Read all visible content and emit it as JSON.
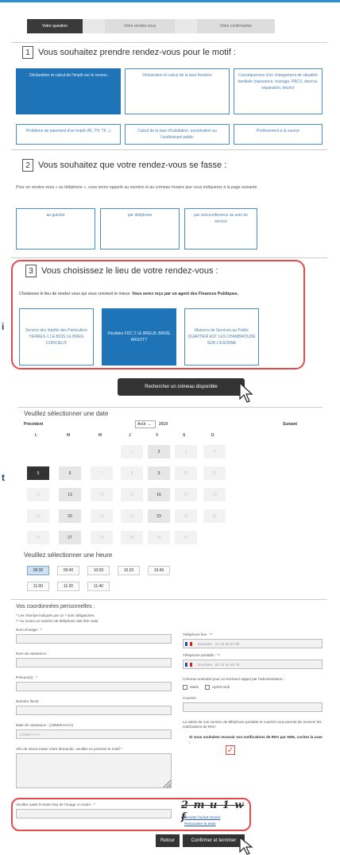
{
  "steps": [
    "Votre question",
    "Votre rendez-vous",
    "Votre confirmation"
  ],
  "s1": {
    "num": "1",
    "title": "Vous souhaitez prendre rendez-vous pour le motif :",
    "cards": [
      "Déclaration et calcul de l'impôt sur le revenu",
      "Déclaration et calcul de la taxe foncière",
      "Conséquences d'un changement de situation familiale (naissance, mariage, PACS, divorce, séparation, décès)",
      "Problème de paiement d'un impôt (IR, TH, TF...)",
      "Calcul de la taxe d'habitation, exonération ou l'audiovisuel public",
      "Prélèvement à la source"
    ]
  },
  "s2": {
    "num": "2",
    "title": "Vous souhaitez que votre rendez-vous se fasse :",
    "para": "Pour un rendez-vous « au téléphone », vous serez rappelé au numéro et au créneau horaire que vous indiquerez à la page suivante.",
    "cards": [
      "au guichet",
      "par téléphone",
      "par visioconférence au sein du service"
    ]
  },
  "s3": {
    "num": "3",
    "title": "Vous choisissez le lieu de votre rendez-vous :",
    "para_a": "Choisissez le lieu de rendez vous qui vous convient le mieux. ",
    "para_b": "Vous serez reçu par un agent des Finances Publiques.",
    "cards": [
      "Service des Impôts des Particuliers YERRES-1 LE BOIS LE BREG CORCIEUX",
      "Flexibles FDC 2 LE BREUIL BRIDE ARGOTT",
      "Maisons de Services au Public QUARTIER EST LES CHAMBROUDE SUR L'ESONNE"
    ]
  },
  "search_btn": "Rechercher un créneau disponible",
  "side": [
    "i",
    "t"
  ],
  "cal": {
    "title": "Veuillez sélectionner une date",
    "prev": "Précédent",
    "next": "Suivant",
    "month": "Août",
    "year": "2019",
    "days": [
      "L",
      "M",
      "M",
      "J",
      "V",
      "S",
      "D"
    ],
    "weeks": [
      [
        "",
        "",
        "",
        "1",
        "2",
        "3",
        "4"
      ],
      [
        "5",
        "6",
        "7",
        "8",
        "9",
        "10",
        "11"
      ],
      [
        "12",
        "13",
        "14",
        "15",
        "16",
        "17",
        "18"
      ],
      [
        "19",
        "20",
        "21",
        "22",
        "23",
        "24",
        "25"
      ],
      [
        "26",
        "27",
        "28",
        "29",
        "30",
        "31",
        ""
      ]
    ],
    "hours_title": "Veuillez sélectionner une heure",
    "hours": [
      "09:30",
      "09:40",
      "10:00",
      "10:20",
      "10:40",
      "11:00",
      "11:20",
      "11:40"
    ]
  },
  "form": {
    "title": "Vos coordonnées personnelles :",
    "note1": "* Les champs indiqués par un * sont obligatoires.",
    "note2": "** Au moins un numéro de téléphone doit être saisi.",
    "nom": "Nom d'usage : *",
    "naissance": "Nom de naissance :",
    "prenom": "Prénom(s) : *",
    "fiscal": "Numéro fiscal :",
    "date": "Date de naissance : (JJ/MM/AAAA)",
    "date_ph": "JJ/MM/YYYY",
    "motif": "Afin de mieux traiter votre demande, veuillez en préciser le motif *",
    "tel_fixe": "Téléphone fixe : **",
    "tel_fixe_ph": "Exemple : 01 23 45 67 89",
    "tel_port": "Téléphone portable : **",
    "tel_port_ph": "Exemple : 06 12 34 56 78",
    "creneau": "Créneau souhaité pour un éventuel rappel par l'administration :",
    "matin": "Matin",
    "apres": "Après-midi",
    "courriel": "Courriel :",
    "notice": "La saisie de vos numéro de téléphone portable et courriel vous permet de recevoir les notifications de RDV",
    "sms": "Si vous souhaitez recevoir vos notifications de RDV par SMS, cochez la case :",
    "captcha_label": "Veuillez saisir le texte issu de l'image ci-contre : *",
    "captcha_text": "2 m u 1 w f",
    "ecouter": "Écouter l'achat sonore",
    "renouveler": "Renouveler le texte"
  },
  "retour": "Retour",
  "confirmer": "Confirmer et terminer",
  "colors": {
    "blue": "#1f74b8",
    "red": "#e34a4a",
    "dark": "#333333",
    "accent": "#2b8fd4"
  }
}
